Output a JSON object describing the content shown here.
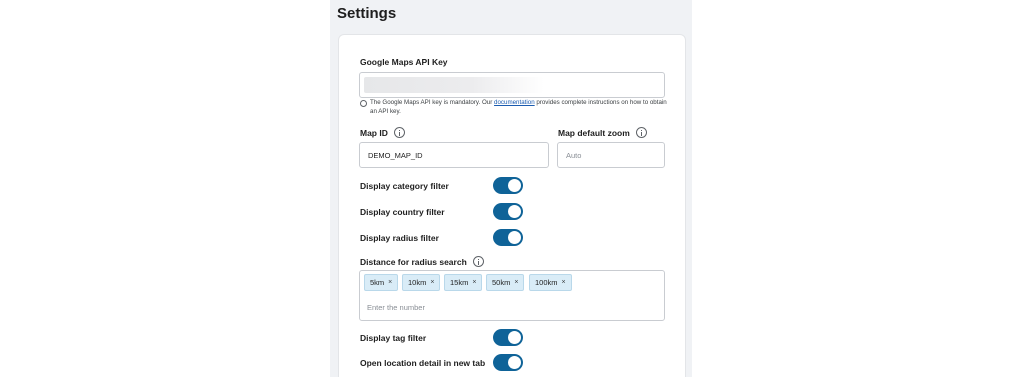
{
  "page": {
    "title": "Settings"
  },
  "api_key": {
    "label": "Google Maps API Key",
    "help_prefix": "The Google Maps API key is mandatory. Our ",
    "help_link": "documentation",
    "help_suffix": " provides complete instructions on how to obtain an API key."
  },
  "map_id": {
    "label": "Map ID",
    "value": "DEMO_MAP_ID"
  },
  "zoom": {
    "label": "Map default zoom",
    "placeholder": "Auto"
  },
  "toggles": {
    "category": {
      "label": "Display category filter",
      "on": true
    },
    "country": {
      "label": "Display country filter",
      "on": true
    },
    "radius": {
      "label": "Display radius filter",
      "on": true
    },
    "tag": {
      "label": "Display tag filter",
      "on": true
    },
    "new_tab": {
      "label": "Open location detail in new tab",
      "on": true
    }
  },
  "radius_search": {
    "label": "Distance for radius search",
    "tags": [
      "5km",
      "10km",
      "15km",
      "50km",
      "100km"
    ],
    "remove_glyph": "×",
    "placeholder": "Enter the number"
  },
  "colors": {
    "accent": "#0f6398",
    "tag_bg": "#d9ecf7",
    "panel_bg": "#f0f2f5"
  }
}
